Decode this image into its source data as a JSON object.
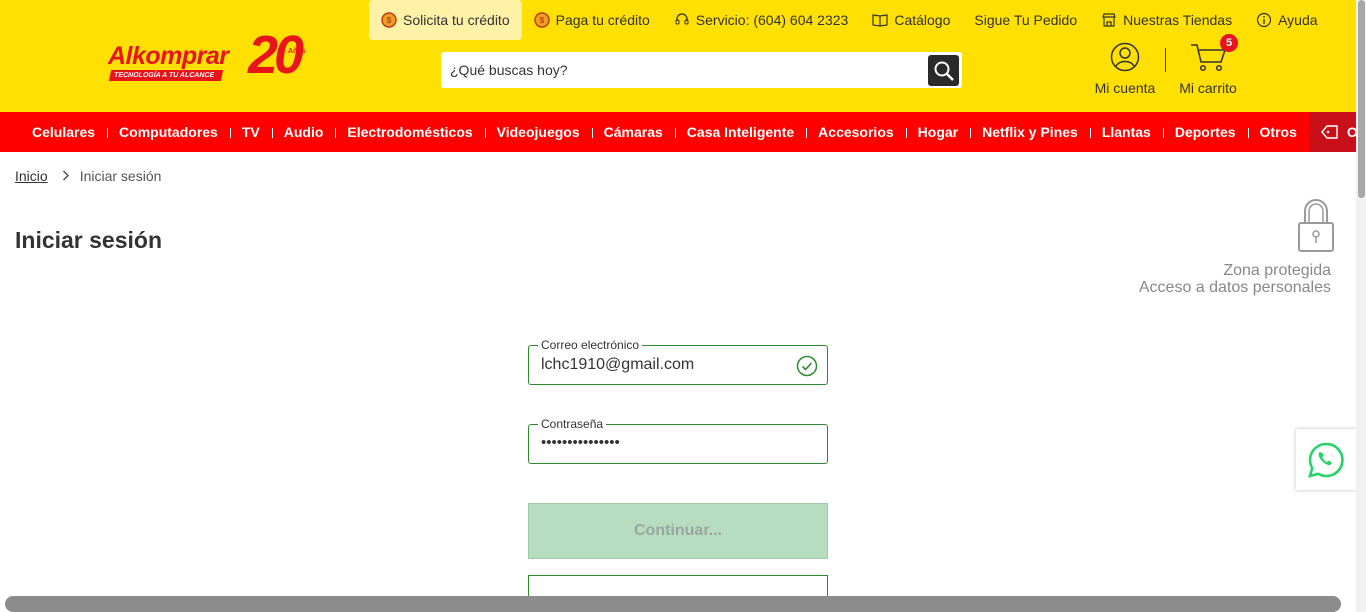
{
  "brand": {
    "logo_text": "Alkomprar",
    "logo_tagline": "TECNOLOGÍA A TU ALCANCE",
    "logo_anniversary": "20",
    "logo_anniversary_sub": "Años"
  },
  "topnav": [
    {
      "label": "Solicita tu crédito",
      "icon": "credit-coin-icon"
    },
    {
      "label": "Paga tu crédito",
      "icon": "pay-coin-icon"
    },
    {
      "label": "Servicio: (604) 604 2323",
      "icon": "headset-icon"
    },
    {
      "label": "Catálogo",
      "icon": "catalog-icon"
    },
    {
      "label": "Sigue Tu Pedido",
      "icon": ""
    },
    {
      "label": "Nuestras Tiendas",
      "icon": "store-icon"
    },
    {
      "label": "Ayuda",
      "icon": "info-icon"
    }
  ],
  "search": {
    "placeholder": "¿Qué buscas hoy?"
  },
  "account": {
    "label": "Mi cuenta"
  },
  "cart": {
    "label": "Mi carrito",
    "count": "5"
  },
  "categories": [
    "Celulares",
    "Computadores",
    "TV",
    "Audio",
    "Electrodomésticos",
    "Videojuegos",
    "Cámaras",
    "Casa Inteligente",
    "Accesorios",
    "Hogar",
    "Netflix y Pines",
    "Llantas",
    "Deportes",
    "Otros"
  ],
  "ofertas": {
    "label": "Ofertas"
  },
  "breadcrumb": {
    "home": "Inicio",
    "current": "Iniciar sesión"
  },
  "page": {
    "title": "Iniciar sesión"
  },
  "protected": {
    "line1": "Zona protegida",
    "line2": "Acceso a datos personales"
  },
  "form": {
    "email_label": "Correo electrónico",
    "email_value": "lchc1910@gmail.com",
    "password_label": "Contraseña",
    "password_value": "•••••••••••••••",
    "continue_label": "Continuar..."
  },
  "colors": {
    "header": "#ffe000",
    "catbar": "#ff0000",
    "ofertas": "#c80f1a",
    "field_border": "#2f8a2f",
    "button": "#b6ddbf"
  }
}
